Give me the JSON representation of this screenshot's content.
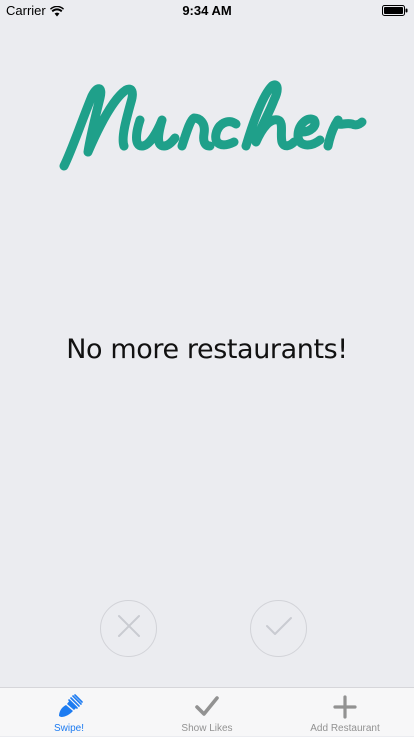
{
  "status_bar": {
    "carrier": "Carrier",
    "time": "9:34 AM",
    "wifi_icon": "wifi-icon",
    "battery_icon": "battery-icon"
  },
  "logo": {
    "text": "Muncher",
    "color": "#1FA08A"
  },
  "main": {
    "empty_message": "No more restaurants!"
  },
  "actions": {
    "reject_icon": "close-icon",
    "accept_icon": "check-icon"
  },
  "tab_bar": {
    "tabs": [
      {
        "label": "Swipe!",
        "icon": "swipe-icon",
        "active": true
      },
      {
        "label": "Show Likes",
        "icon": "check-icon",
        "active": false
      },
      {
        "label": "Add Restaurant",
        "icon": "plus-icon",
        "active": false
      }
    ],
    "active_color": "#1E7CF1",
    "inactive_color": "#929292"
  }
}
